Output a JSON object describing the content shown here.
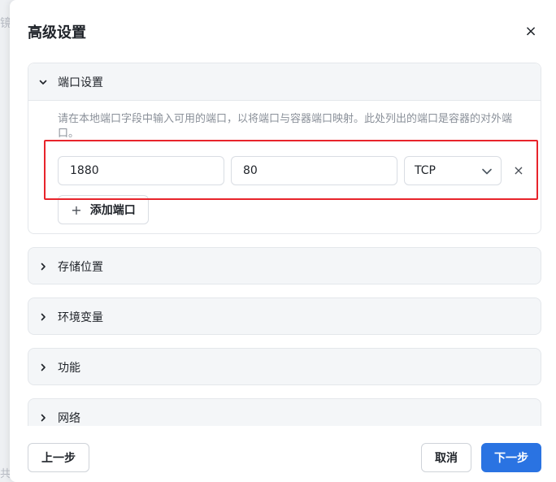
{
  "dialog": {
    "title": "高级设置",
    "close_glyph": "×"
  },
  "sections": [
    {
      "label": "端口设置",
      "expanded": true
    },
    {
      "label": "存储位置",
      "expanded": false
    },
    {
      "label": "环境变量",
      "expanded": false
    },
    {
      "label": "功能",
      "expanded": false
    },
    {
      "label": "网络",
      "expanded": false
    }
  ],
  "ports": {
    "hint": "请在本地端口字段中输入可用的端口，以将端口与容器端口映射。此处列出的端口是容器的对外端口。",
    "rows": [
      {
        "local_port": "1880",
        "container_port": "80",
        "protocol": "TCP",
        "remove_glyph": "×"
      }
    ],
    "add_label": "添加端口",
    "add_glyph": "+"
  },
  "footer": {
    "prev_label": "上一步",
    "cancel_label": "取消",
    "next_label": "下一步"
  },
  "colors": {
    "primary": "#2a73e2",
    "highlight_border": "#e8242b"
  }
}
